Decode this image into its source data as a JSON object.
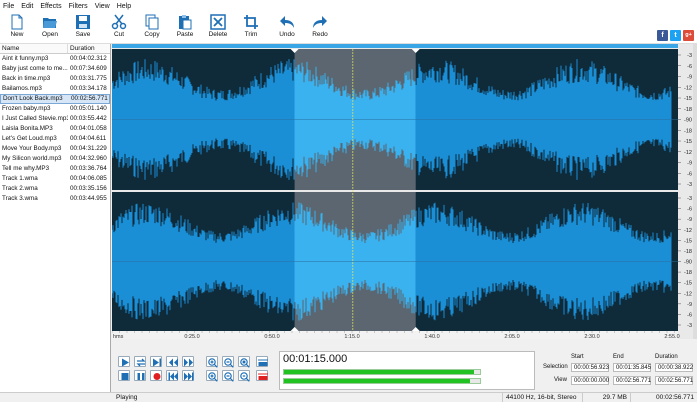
{
  "menu": [
    "File",
    "Edit",
    "Effects",
    "Filters",
    "View",
    "Help"
  ],
  "toolbar": [
    {
      "label": "New",
      "icon": "new-file-icon"
    },
    {
      "label": "Open",
      "icon": "open-folder-icon"
    },
    {
      "label": "Save",
      "icon": "save-icon"
    },
    {
      "label": "Cut",
      "icon": "cut-icon"
    },
    {
      "label": "Copy",
      "icon": "copy-icon"
    },
    {
      "label": "Paste",
      "icon": "paste-icon"
    },
    {
      "label": "Delete",
      "icon": "delete-icon"
    },
    {
      "label": "Trim",
      "icon": "trim-icon"
    },
    {
      "label": "Undo",
      "icon": "undo-icon"
    },
    {
      "label": "Redo",
      "icon": "redo-icon"
    }
  ],
  "social": [
    {
      "label": "f",
      "color": "#3b5998",
      "icon": "facebook-icon"
    },
    {
      "label": "t",
      "color": "#1da1f2",
      "icon": "twitter-icon"
    },
    {
      "label": "g+",
      "color": "#dd4b39",
      "icon": "google-plus-icon"
    }
  ],
  "file_list": {
    "headers": [
      "Name",
      "Duration"
    ],
    "selected_index": 4,
    "rows": [
      {
        "name": "Aint it funny.mp3",
        "duration": "00:04:02.312"
      },
      {
        "name": "Baby just come to me...",
        "duration": "00:07:34.609"
      },
      {
        "name": "Back in time.mp3",
        "duration": "00:03:31.775"
      },
      {
        "name": "Bailamos.mp3",
        "duration": "00:03:34.178"
      },
      {
        "name": "Don't Look Back.mp3",
        "duration": "00:02:56.771"
      },
      {
        "name": "Frozen baby.mp3",
        "duration": "00:05:01.140"
      },
      {
        "name": "I Just Called  Stevie.mp3",
        "duration": "00:03:55.442"
      },
      {
        "name": "Laisla Bonita.MP3",
        "duration": "00:04:01.058"
      },
      {
        "name": "Let's Get Loud.mp3",
        "duration": "00:04:04.611"
      },
      {
        "name": "Move Your Body.mp3",
        "duration": "00:04:31.229"
      },
      {
        "name": "My Silicon world.mp3",
        "duration": "00:04:32.960"
      },
      {
        "name": "Tell me why.MP3",
        "duration": "00:03:36.764"
      },
      {
        "name": "Track 1.wma",
        "duration": "00:04:06.085"
      },
      {
        "name": "Track 2.wma",
        "duration": "00:03:35.156"
      },
      {
        "name": "Track 3.wma",
        "duration": "00:03:44.955"
      }
    ]
  },
  "timeline": {
    "ticks": [
      "hms",
      "0:25.0",
      "0:50.0",
      "1:15.0",
      "1:40.0",
      "2:05.0",
      "2:30.0",
      "2:55.0"
    ],
    "db_scale": [
      "-3",
      "-6",
      "-9",
      "-12",
      "-15",
      "-18",
      "-90",
      "-18",
      "-15",
      "-12",
      "-9",
      "-6",
      "-3"
    ]
  },
  "selection_fraction": {
    "start": 0.3226,
    "end": 0.5366
  },
  "cursor_fraction": 0.4255,
  "transport": {
    "time": "00:01:15.000",
    "level_left": 0.97,
    "level_right": 0.95
  },
  "selection": {
    "headers": [
      "Start",
      "End",
      "Duration"
    ],
    "rows": [
      {
        "label": "Selection",
        "start": "00:00:56.923",
        "end": "00:01:35.845",
        "duration": "00:00:38.922"
      },
      {
        "label": "View",
        "start": "00:00:00.000",
        "end": "00:02:56.771",
        "duration": "00:02:56.771"
      }
    ]
  },
  "status": {
    "state": "Playing",
    "format": "44100 Hz, 16-bit, Stereo",
    "size": "29.7 MB",
    "length": "00:02:56.771"
  },
  "colors": {
    "wave": "#1a8fd6",
    "wave_selected": "#3ab2ef",
    "wave_bg": "#0f2a38",
    "selection_bg": "#5b6670",
    "level": "#22c222"
  }
}
